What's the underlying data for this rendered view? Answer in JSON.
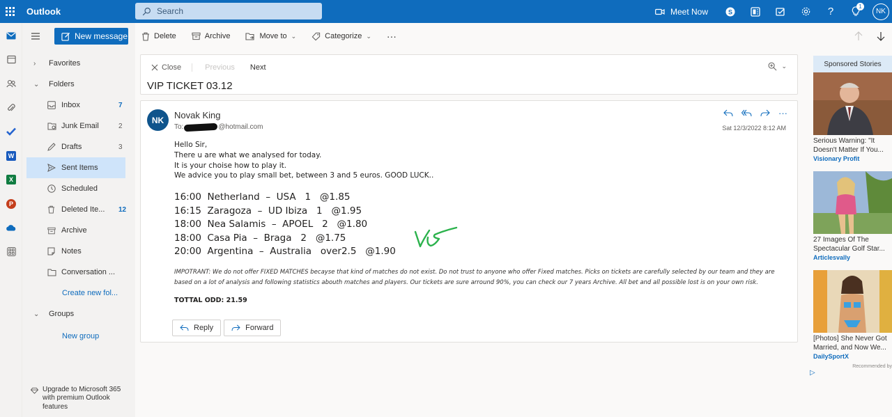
{
  "app": {
    "name": "Outlook",
    "search_placeholder": "Search",
    "meet_now": "Meet Now",
    "user_initials": "NK",
    "tips_badge": "1"
  },
  "colors": {
    "brand": "#0f6cbd",
    "selected": "#cfe4fa",
    "avatar": "#0f548c",
    "scribble": "#2bb24c"
  },
  "rail": [
    "mail-icon",
    "calendar-icon",
    "people-icon",
    "attach-icon",
    "todo-icon",
    "word-icon",
    "excel-icon",
    "powerpoint-icon",
    "onedrive-icon",
    "apps-icon"
  ],
  "folders": {
    "new_message": "New message",
    "favorites": "Favorites",
    "folders_label": "Folders",
    "items": [
      {
        "name": "Inbox",
        "count": "7",
        "icon": "inbox-icon"
      },
      {
        "name": "Junk Email",
        "count": "2",
        "icon": "junk-icon"
      },
      {
        "name": "Drafts",
        "count": "3",
        "icon": "drafts-icon"
      },
      {
        "name": "Sent Items",
        "count": "",
        "icon": "sent-icon"
      },
      {
        "name": "Scheduled",
        "count": "",
        "icon": "clock-icon"
      },
      {
        "name": "Deleted Ite...",
        "count": "12",
        "icon": "trash-icon"
      },
      {
        "name": "Archive",
        "count": "",
        "icon": "archive-icon"
      },
      {
        "name": "Notes",
        "count": "",
        "icon": "notes-icon"
      },
      {
        "name": "Conversation ...",
        "count": "",
        "icon": "folder-icon"
      }
    ],
    "create_new": "Create new fol...",
    "groups": "Groups",
    "new_group": "New group",
    "upgrade": "Upgrade to Microsoft 365 with premium Outlook features"
  },
  "commands": {
    "delete": "Delete",
    "archive": "Archive",
    "move_to": "Move to",
    "categorize": "Categorize",
    "more": "···"
  },
  "nav": {
    "close": "Close",
    "previous": "Previous",
    "next": "Next"
  },
  "message": {
    "subject": "VIP TICKET 03.12",
    "sender_initials": "NK",
    "sender": "Novak King",
    "to_prefix": "To:",
    "to_domain": "@hotmail.com",
    "date": "Sat 12/3/2022 8:12 AM",
    "greeting_lines": [
      "Hello Sir,",
      "There u are what we analysed for today.",
      "It is your choise how to play it.",
      "We advice you to play small bet, between 3 and 5 euros. GOOD LUCK.."
    ],
    "picks": [
      "16:00  Netherland  –  USA   1   @1.85",
      "16:15  Zaragoza  –  UD Ibiza   1   @1.95",
      "18:00  Nea Salamis  –  APOEL   2   @1.80",
      "18:00  Casa Pia  –  Braga   2   @1.75",
      "20:00  Argentina  –  Australia   over2.5   @1.90"
    ],
    "disclaimer": "IMPOTRANT: We do not offer FIXED MATCHES becayse that kind of matches do not exist. Do not trust to anyone who offer Fixed matches. Picks on tickets are carefully selected by our team and they are based on a lot of analysis and following statistics abouth matches and players. Our tickets are sure arround 90%, you can check our 7 years Archive. All bet and all possible lost is on your own risk.",
    "total": "TOTTAL ODD: 21.59",
    "reply": "Reply",
    "forward": "Forward"
  },
  "ads": {
    "header": "Sponsored Stories",
    "items": [
      {
        "title": "Serious Warning: \"It Doesn't Matter If You...",
        "source": "Visionary Profit"
      },
      {
        "title": "27 Images Of The Spectacular Golf Star...",
        "source": "Articlesvally"
      },
      {
        "title": "[Photos] She Never Got Married, and Now We...",
        "source": "DailySportX"
      }
    ],
    "recommended": "Recommended by"
  }
}
